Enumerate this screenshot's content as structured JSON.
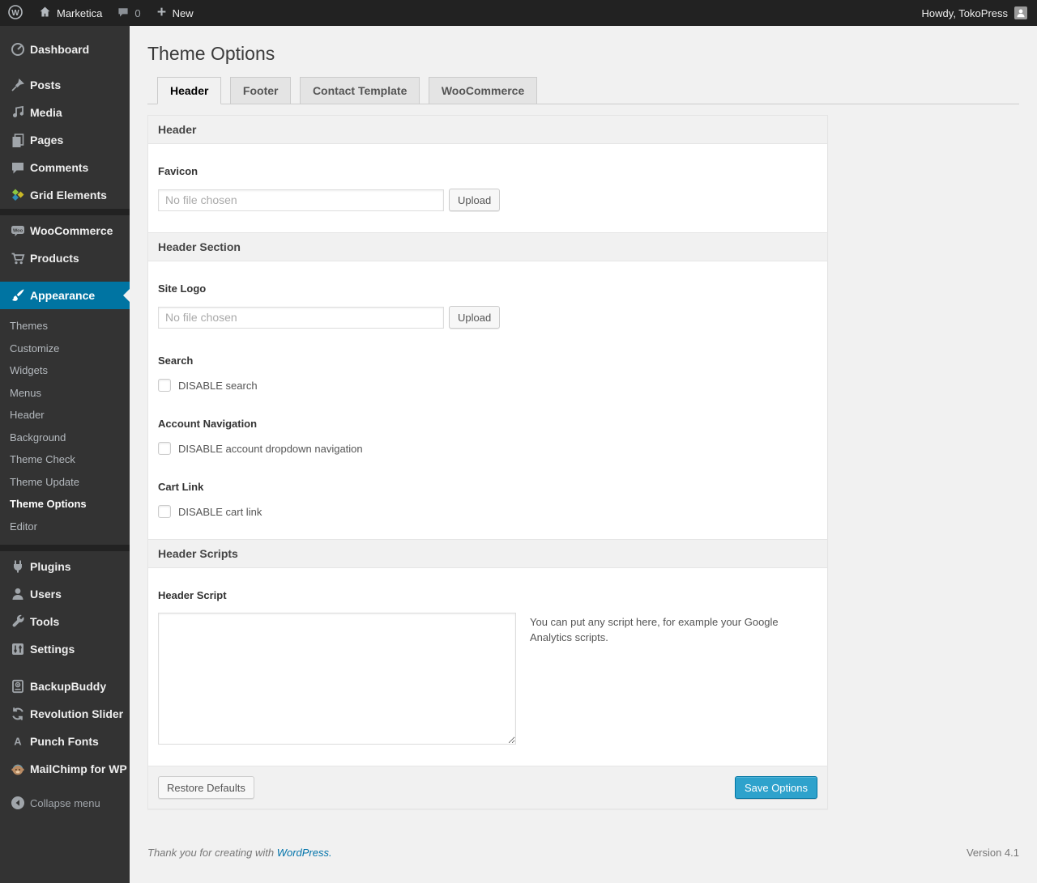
{
  "colors": {
    "accent_selected_menu": "#0074a2",
    "primary_button": "#2ea2cc",
    "link": "#0073aa",
    "adminbar_bg": "#222222",
    "sidebar_bg": "#333333",
    "page_bg": "#f1f1f1"
  },
  "admin_bar": {
    "site_name": "Marketica",
    "comments_count": "0",
    "new_label": "New",
    "howdy": "Howdy, TokoPress"
  },
  "sidebar": {
    "items": [
      {
        "label": "Dashboard",
        "icon": "dashboard-icon"
      },
      {
        "label": "Posts",
        "icon": "pushpin-icon"
      },
      {
        "label": "Media",
        "icon": "media-icon"
      },
      {
        "label": "Pages",
        "icon": "pages-icon"
      },
      {
        "label": "Comments",
        "icon": "comments-icon"
      },
      {
        "label": "Grid Elements",
        "icon": "grid-elements-icon"
      },
      {
        "label": "WooCommerce",
        "icon": "woocommerce-icon"
      },
      {
        "label": "Products",
        "icon": "cart-icon"
      },
      {
        "label": "Appearance",
        "icon": "paintbrush-icon",
        "selected": true
      },
      {
        "label": "Plugins",
        "icon": "plugin-icon"
      },
      {
        "label": "Users",
        "icon": "user-icon"
      },
      {
        "label": "Tools",
        "icon": "wrench-icon"
      },
      {
        "label": "Settings",
        "icon": "sliders-icon"
      },
      {
        "label": "BackupBuddy",
        "icon": "backup-drive-icon"
      },
      {
        "label": "Revolution Slider",
        "icon": "refresh-arrows-icon"
      },
      {
        "label": "Punch Fonts",
        "icon": "letter-a-icon"
      },
      {
        "label": "MailChimp for WP",
        "icon": "monkey-icon"
      }
    ],
    "submenu": [
      "Themes",
      "Customize",
      "Widgets",
      "Menus",
      "Header",
      "Background",
      "Theme Check",
      "Theme Update",
      "Theme Options",
      "Editor"
    ],
    "submenu_current": "Theme Options",
    "collapse_label": "Collapse menu"
  },
  "content": {
    "title": "Theme Options",
    "tabs": [
      "Header",
      "Footer",
      "Contact Template",
      "WooCommerce"
    ],
    "active_tab": "Header",
    "section1_title": "Header",
    "favicon_label": "Favicon",
    "favicon_placeholder": "No file chosen",
    "upload_label": "Upload",
    "section2_title": "Header Section",
    "site_logo_label": "Site Logo",
    "site_logo_placeholder": "No file chosen",
    "search_label": "Search",
    "search_checkbox": "DISABLE search",
    "account_nav_label": "Account Navigation",
    "account_nav_checkbox": "DISABLE account dropdown navigation",
    "cart_link_label": "Cart Link",
    "cart_link_checkbox": "DISABLE cart link",
    "section3_title": "Header Scripts",
    "header_script_label": "Header Script",
    "header_script_value": "",
    "header_script_help": "You can put any script here, for example your Google Analytics scripts.",
    "restore_button": "Restore Defaults",
    "save_button": "Save Options"
  },
  "footer": {
    "thanks_prefix": "Thank you for creating with",
    "wordpress_link": "WordPress.",
    "version": "Version 4.1"
  }
}
